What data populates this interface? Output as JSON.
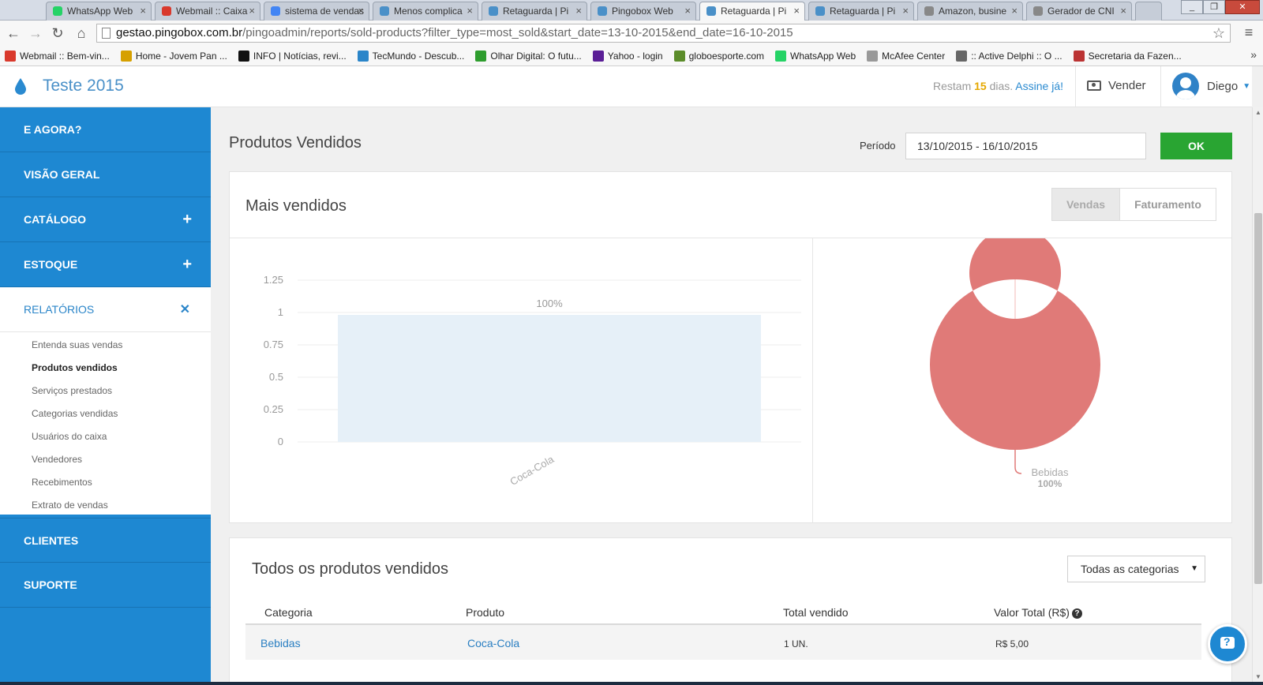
{
  "browser": {
    "tabs": [
      {
        "label": "WhatsApp Web",
        "color": "#25d366"
      },
      {
        "label": "Webmail :: Caixa",
        "color": "#d9392c"
      },
      {
        "label": "sistema de vendas",
        "color": "#4285f4"
      },
      {
        "label": "Menos complica",
        "color": "#4a90c8"
      },
      {
        "label": "Retaguarda | Pi",
        "color": "#4a90c8"
      },
      {
        "label": "Pingobox Web",
        "color": "#4a90c8"
      },
      {
        "label": "Retaguarda | Pi",
        "color": "#4a90c8",
        "active": true
      },
      {
        "label": "Retaguarda | Pi",
        "color": "#4a90c8"
      },
      {
        "label": "Amazon, busine",
        "color": "#888888"
      },
      {
        "label": "Gerador de CNI",
        "color": "#888888"
      }
    ],
    "url_host": "gestao.pingobox.com.br",
    "url_path": "/pingoadmin/reports/sold-products?filter_type=most_sold&start_date=13-10-2015&end_date=16-10-2015",
    "bookmarks": [
      {
        "label": "Webmail :: Bem-vin...",
        "color": "#d9392c"
      },
      {
        "label": "Home - Jovem Pan ...",
        "color": "#d6a000"
      },
      {
        "label": "INFO | Notícias, revi...",
        "color": "#111111"
      },
      {
        "label": "TecMundo - Descub...",
        "color": "#2a85c9"
      },
      {
        "label": "Olhar Digital: O futu...",
        "color": "#2e9d2e"
      },
      {
        "label": "Yahoo - login",
        "color": "#5a1e96"
      },
      {
        "label": "globoesporte.com",
        "color": "#5b8c2a"
      },
      {
        "label": "WhatsApp Web",
        "color": "#25d366"
      },
      {
        "label": "McAfee Center",
        "color": "#999999"
      },
      {
        "label": ":: Active Delphi :: O ...",
        "color": "#666666"
      },
      {
        "label": "Secretaria da Fazen...",
        "color": "#b33"
      }
    ]
  },
  "header": {
    "brand": "Teste 2015",
    "trial_prefix": "Restam",
    "trial_days": "15",
    "trial_suffix": "dias.",
    "subscribe": "Assine já!",
    "sell": "Vender",
    "user": "Diego"
  },
  "sidebar": {
    "items": [
      {
        "label": "E AGORA?",
        "has_plus": false
      },
      {
        "label": "VISÃO GERAL",
        "has_plus": false
      },
      {
        "label": "CATÁLOGO",
        "has_plus": true
      },
      {
        "label": "ESTOQUE",
        "has_plus": true
      }
    ],
    "active": "RELATÓRIOS",
    "submenu": [
      "Entenda suas vendas",
      "Produtos vendidos",
      "Serviços prestados",
      "Categorias vendidas",
      "Usuários do caixa",
      "Vendedores",
      "Recebimentos",
      "Extrato de vendas"
    ],
    "current_sub": "Produtos vendidos",
    "bottom_items": [
      "CLIENTES",
      "SUPORTE"
    ]
  },
  "main": {
    "title": "Produtos Vendidos",
    "period_label": "Período",
    "period_value": "13/10/2015 - 16/10/2015",
    "ok": "OK",
    "chart_panel": {
      "title": "Mais vendidos",
      "toggle_sales": "Vendas",
      "toggle_revenue": "Faturamento"
    },
    "table_panel": {
      "title": "Todos os produtos vendidos",
      "category_filter": "Todas as categorias",
      "columns": [
        "Categoria",
        "Produto",
        "Total vendido",
        "Valor Total (R$)"
      ],
      "rows": [
        {
          "categoria": "Bebidas",
          "produto": "Coca-Cola",
          "total": "1 UN.",
          "valor": "R$ 5,00"
        }
      ]
    }
  },
  "chart_data": [
    {
      "type": "bar",
      "categories": [
        "Coca-Cola"
      ],
      "values": [
        1
      ],
      "data_labels": [
        "100%"
      ],
      "ylim": [
        0,
        1.25
      ],
      "yticks": [
        "1.25",
        "1",
        "0.75",
        "0.5",
        "0.25",
        "0"
      ],
      "grid": true,
      "color": "#e6f0f8"
    },
    {
      "type": "pie",
      "donut": true,
      "labels": [
        "Bebidas"
      ],
      "values": [
        100
      ],
      "label_values": [
        "100%"
      ],
      "color": "#e07a78"
    }
  ]
}
